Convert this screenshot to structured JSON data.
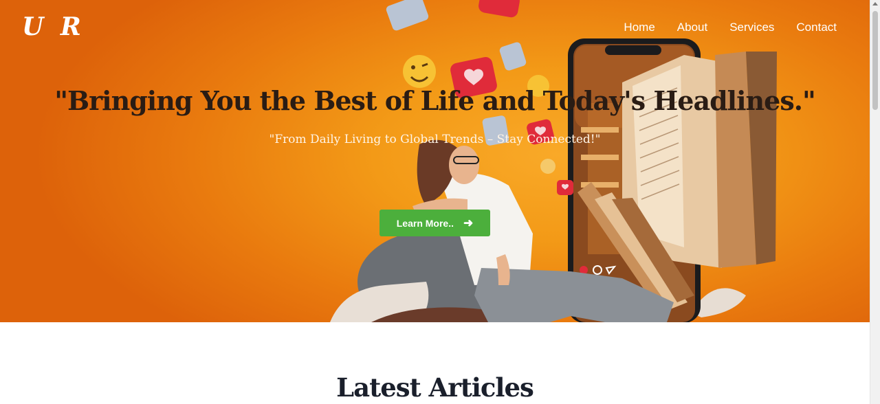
{
  "header": {
    "logo": "U R",
    "nav": [
      {
        "label": "Home"
      },
      {
        "label": "About"
      },
      {
        "label": "Services"
      },
      {
        "label": "Contact"
      }
    ]
  },
  "hero": {
    "headline": "\"Bringing You the Best of Life and Today's Headlines.\"",
    "subline": "\"From Daily Living to Global Trends – Stay Connected!\"",
    "cta_label": "Learn More.."
  },
  "articles": {
    "title": "Latest Articles"
  },
  "colors": {
    "hero_orange": "#f39a17",
    "button_green": "#4caf3c",
    "heart_red": "#e02b3a"
  }
}
